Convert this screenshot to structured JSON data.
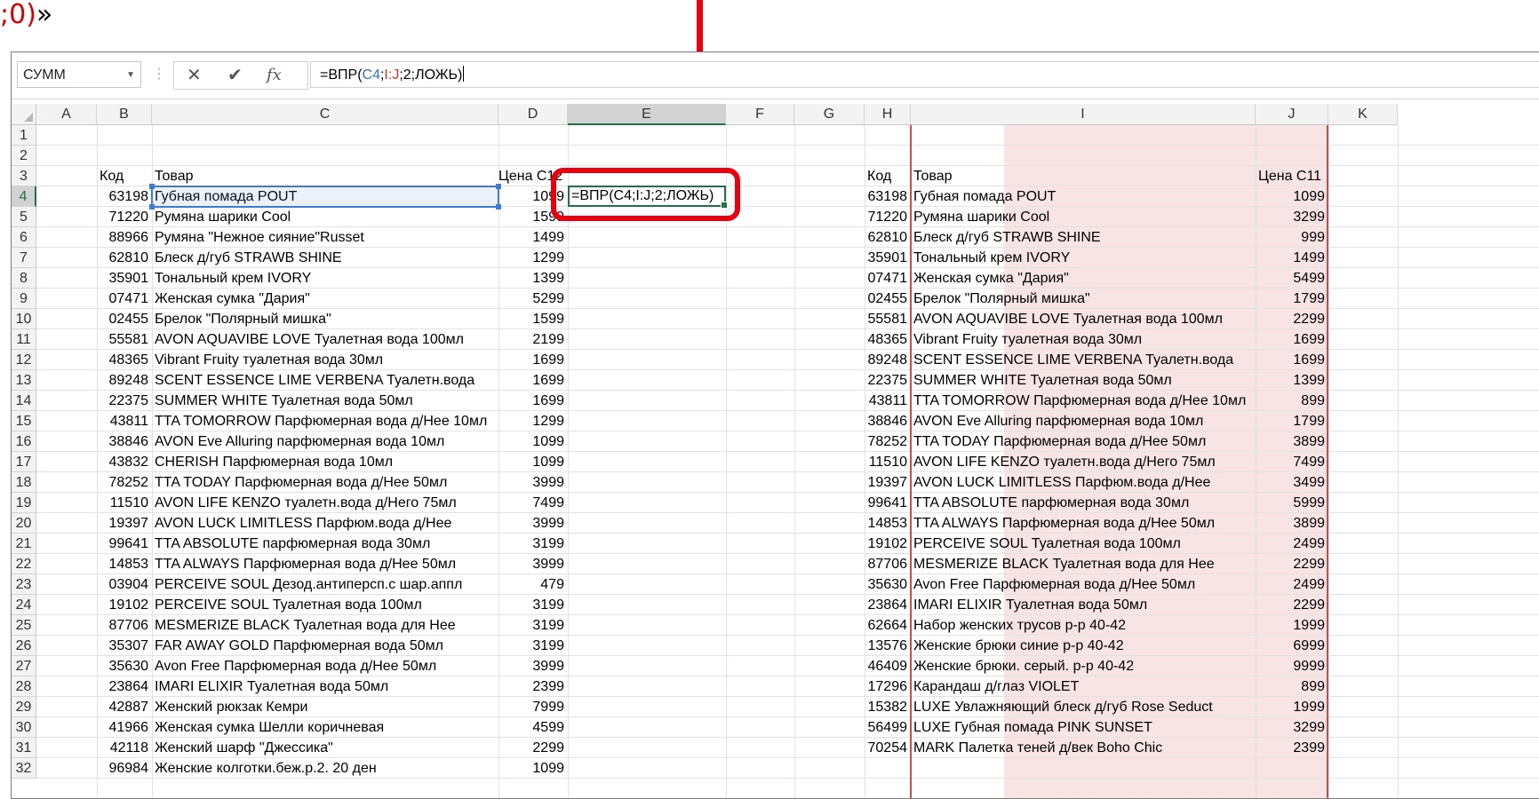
{
  "caption": {
    "red": ";0)",
    "black": "»"
  },
  "formula_bar": {
    "name_box": "СУММ",
    "formula_parts": [
      "=ВПР(",
      "C4",
      ";",
      "I:J",
      ";2;ЛОЖЬ)"
    ],
    "cancel_icon": "close-icon",
    "enter_icon": "check-icon",
    "fx_label": "fx"
  },
  "columns": [
    "A",
    "B",
    "C",
    "D",
    "E",
    "F",
    "G",
    "H",
    "I",
    "J",
    "K"
  ],
  "active_column": "E",
  "active_row": 4,
  "rows": [
    1,
    2,
    3,
    4,
    5,
    6,
    7,
    8,
    9,
    10,
    11,
    12,
    13,
    14,
    15,
    16,
    17,
    18,
    19,
    20,
    21,
    22,
    23,
    24,
    25,
    26,
    27,
    28,
    29,
    30,
    31,
    32
  ],
  "left_table": {
    "headers": {
      "code": "Код",
      "product": "Товар",
      "price": "Цена С12"
    },
    "rows": [
      [
        "63198",
        "Губная помада POUT",
        "1099"
      ],
      [
        "71220",
        "Румяна шарики Cool",
        "1599"
      ],
      [
        "88966",
        "Румяна \"Нежное сияние\"Russet",
        "1499"
      ],
      [
        "62810",
        "Блеск д/губ STRAWB SHINE",
        "1299"
      ],
      [
        "35901",
        "Тональный крем IVORY",
        "1399"
      ],
      [
        "07471",
        "Женская сумка \"Дария\"",
        "5299"
      ],
      [
        "02455",
        "Брелок \"Полярный мишка\"",
        "1599"
      ],
      [
        "55581",
        "AVON AQUAVIBE LOVE Туалетная вода 100мл",
        "2199"
      ],
      [
        "48365",
        "Vibrant Fruity туалетная вода 30мл",
        "1699"
      ],
      [
        "89248",
        "SCENT ESSENCE LIME VERBENA Туалетн.вода",
        "1699"
      ],
      [
        "22375",
        "SUMMER WHITE Туалетная вода 50мл",
        "1699"
      ],
      [
        "43811",
        "TTA TOMORROW Парфюмерная вода д/Нее 10мл",
        "1299"
      ],
      [
        "38846",
        "AVON Eve Alluring парфюмерная вода 10мл",
        "1099"
      ],
      [
        "43832",
        "CHERISH Парфюмерная вода 10мл",
        "1099"
      ],
      [
        "78252",
        "TTA TODAY Парфюмерная вода д/Нее 50мл",
        "3999"
      ],
      [
        "11510",
        "AVON LIFE KENZO туалетн.вода д/Него 75мл",
        "7499"
      ],
      [
        "19397",
        "AVON LUCK LIMITLESS Парфюм.вода д/Нее",
        "3999"
      ],
      [
        "99641",
        "TTA ABSOLUTE парфюмерная вода 30мл",
        "3199"
      ],
      [
        "14853",
        "TTA ALWAYS Парфюмерная вода д/Нее 50мл",
        "3999"
      ],
      [
        "03904",
        "PERCEIVE SOUL Дезод.антиперсп.с шар.аппл",
        "479"
      ],
      [
        "19102",
        "PERCEIVE SOUL Туалетная вода 100мл",
        "3199"
      ],
      [
        "87706",
        "MESMERIZE BLACK Туалетная вода для Нее",
        "3199"
      ],
      [
        "35307",
        "FAR AWAY GOLD Парфюмерная вода 50мл",
        "3199"
      ],
      [
        "35630",
        "Avon Free Парфюмерная вода д/Нее 50мл",
        "3999"
      ],
      [
        "23864",
        "IMARI ELIXIR Туалетная вода 50мл",
        "2399"
      ],
      [
        "42887",
        "Женский рюкзак Кемри",
        "7999"
      ],
      [
        "41966",
        "Женская сумка Шелли коричневая",
        "4599"
      ],
      [
        "42118",
        "Женский шарф \"Джессика\"",
        "2299"
      ],
      [
        "96984",
        "Женские колготки.беж.р.2. 20 ден",
        "1099"
      ]
    ]
  },
  "active_cell_text": "=ВПР(C4;I:J;2;ЛОЖЬ)",
  "right_table": {
    "headers": {
      "code": "Код",
      "product": "Товар",
      "price": "Цена С11"
    },
    "rows": [
      [
        "63198",
        "Губная помада POUT",
        "1099"
      ],
      [
        "71220",
        "Румяна шарики Cool",
        "3299"
      ],
      [
        "62810",
        "Блеск д/губ STRAWB SHINE",
        "999"
      ],
      [
        "35901",
        "Тональный крем IVORY",
        "1499"
      ],
      [
        "07471",
        "Женская сумка \"Дария\"",
        "5499"
      ],
      [
        "02455",
        "Брелок \"Полярный мишка\"",
        "1799"
      ],
      [
        "55581",
        "AVON AQUAVIBE LOVE Туалетная вода 100мл",
        "2299"
      ],
      [
        "48365",
        "Vibrant Fruity туалетная вода 30мл",
        "1699"
      ],
      [
        "89248",
        "SCENT ESSENCE LIME VERBENA Туалетн.вода",
        "1699"
      ],
      [
        "22375",
        "SUMMER WHITE Туалетная вода 50мл",
        "1399"
      ],
      [
        "43811",
        "TTA TOMORROW Парфюмерная вода д/Нее 10мл",
        "899"
      ],
      [
        "38846",
        "AVON Eve Alluring парфюмерная вода 10мл",
        "1799"
      ],
      [
        "78252",
        "TTA TODAY Парфюмерная вода д/Нее 50мл",
        "3899"
      ],
      [
        "11510",
        "AVON LIFE KENZO туалетн.вода д/Него 75мл",
        "7499"
      ],
      [
        "19397",
        "AVON LUCK LIMITLESS Парфюм.вода д/Нее",
        "3499"
      ],
      [
        "99641",
        "TTA ABSOLUTE парфюмерная вода 30мл",
        "5999"
      ],
      [
        "14853",
        "TTA ALWAYS Парфюмерная вода д/Нее 50мл",
        "3899"
      ],
      [
        "19102",
        "PERCEIVE SOUL Туалетная вода 100мл",
        "2499"
      ],
      [
        "87706",
        "MESMERIZE BLACK Туалетная вода для Нее",
        "2299"
      ],
      [
        "35630",
        "Avon Free Парфюмерная вода д/Нее 50мл",
        "2499"
      ],
      [
        "23864",
        "IMARI ELIXIR Туалетная вода 50мл",
        "2299"
      ],
      [
        "62664",
        "Набор женских трусов р-р 40-42",
        "1999"
      ],
      [
        "13576",
        "Женские брюки синие р-р 40-42",
        "6999"
      ],
      [
        "46409",
        "Женские брюки. серый. р-р 40-42",
        "9999"
      ],
      [
        "17296",
        "Карандаш д/глаз VIOLET",
        "899"
      ],
      [
        "15382",
        "LUXE Увлажняющий блеск д/губ Rose Seduct",
        "1999"
      ],
      [
        "56499",
        "LUXE Губная помада PINK SUNSET",
        "3299"
      ],
      [
        "70254",
        "MARK Палетка теней д/век Boho Chic",
        "2399"
      ]
    ]
  },
  "colors": {
    "accent_green": "#217346",
    "annotation_red": "#e8000f",
    "ref_blue": "#2e6fc4",
    "ref_red": "#c0392b",
    "range_shade": "#f8e4e4"
  }
}
